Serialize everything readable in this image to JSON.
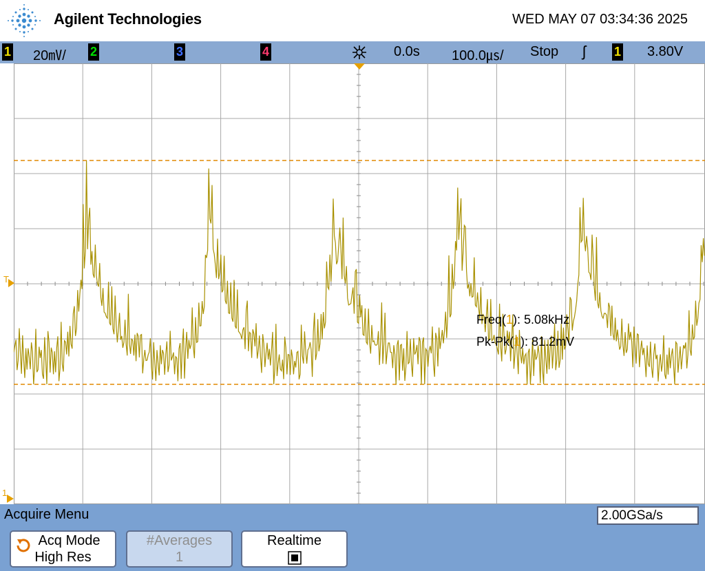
{
  "header": {
    "brand": "Agilent Technologies",
    "datetime": "WED MAY 07 03:34:36 2025"
  },
  "status_bar": {
    "ch1_label": "1",
    "ch1_scale": "20㎷/",
    "ch2_label": "2",
    "ch3_label": "3",
    "ch4_label": "4",
    "time_delay": "0.0s",
    "time_scale": "100.0㎲/",
    "run_state": "Stop",
    "trigger_edge": "ʃ",
    "trigger_source": "1",
    "trigger_level": "3.80V",
    "colors": {
      "ch1": "#f0e000",
      "ch2": "#00e000",
      "ch3": "#3f6fff",
      "ch4": "#ff3a6f"
    }
  },
  "screen": {
    "trigger_marker": "T",
    "ground_marker": "1",
    "measurements": [
      {
        "name": "Freq",
        "source": "1",
        "value": ": 5.08kHz"
      },
      {
        "name": "Pk-Pk",
        "source": "1",
        "value": ": 81.2mV"
      }
    ],
    "trace_color": "#a89000",
    "cursor_color": "#e08800"
  },
  "menu": {
    "title": "Acquire Menu",
    "sample_rate": "2.00GSa/s",
    "softkeys": [
      {
        "line1": "Acq Mode",
        "line2": "High Res",
        "enabled": true,
        "icon": "rotate-icon"
      },
      {
        "line1": "#Averages",
        "line2": "1",
        "enabled": false
      },
      {
        "line1": "Realtime",
        "line2": "",
        "enabled": true,
        "icon": "checkbox-checked-icon"
      }
    ]
  },
  "chart_data": {
    "type": "line",
    "title": "",
    "xlabel": "",
    "ylabel": "",
    "series": [
      {
        "name": "1",
        "description_peaks": 5,
        "values": []
      }
    ],
    "frequency_khz": 5.08,
    "pk_pk_mv": 81.2,
    "grid": true
  }
}
